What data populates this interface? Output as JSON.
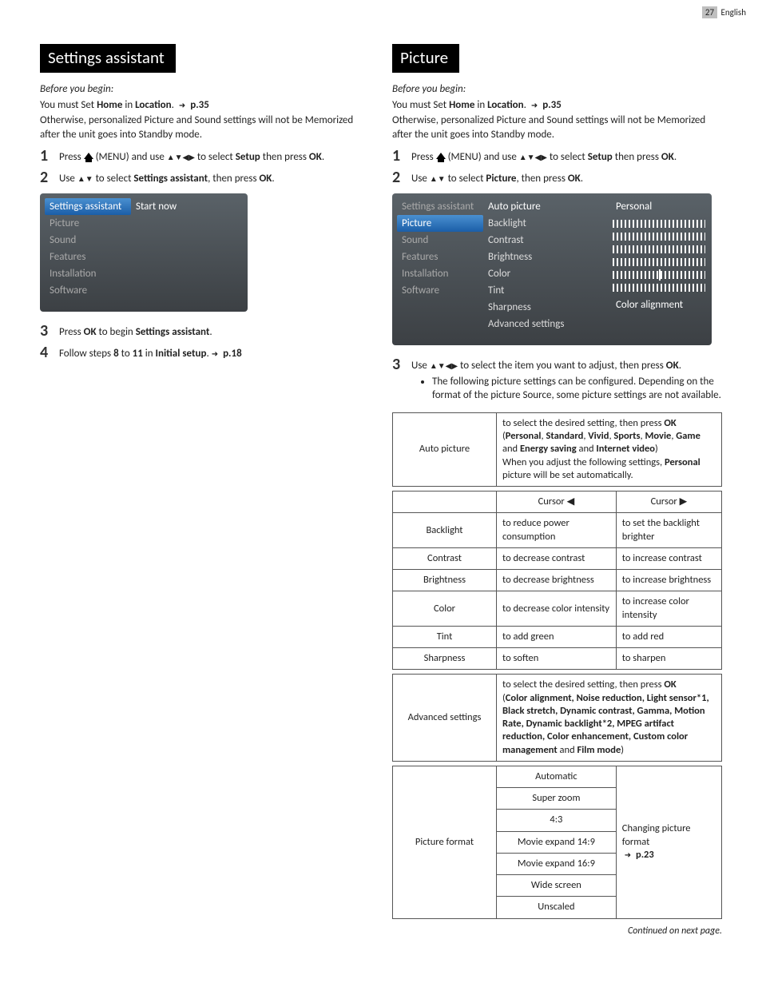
{
  "header": {
    "page_num": "27",
    "lang": "English"
  },
  "left": {
    "title": "Settings assistant",
    "before": "Before you begin:",
    "must_set": "You must Set ",
    "home": "Home",
    "in": " in ",
    "location": "Location",
    "period": ". ",
    "pref": "p.35",
    "otherwise": "Otherwise, personalized Picture and Sound settings will not be Memorized after the unit goes into Standby mode.",
    "steps": {
      "s1a": "Press ",
      "s1b": " (MENU) and use ",
      "s1c": " to select ",
      "s1d": " then press ",
      "setup": "Setup",
      "ok": "OK",
      "s2a": "Use ",
      "s2b": " to select ",
      "s2c": ", then press ",
      "sa": "Settings assistant",
      "s3a": "Press ",
      "s3b": " to begin ",
      "s4a": "Follow steps ",
      "s4b": " to ",
      "s4c": " in ",
      "eight": "8",
      "eleven": "11",
      "initial": "Initial setup",
      "p18": "p.18"
    },
    "menu": {
      "head": "Settings assistant",
      "right": "Start now",
      "items": [
        "Picture",
        "Sound",
        "Features",
        "Installation",
        "Software"
      ]
    }
  },
  "right": {
    "title": "Picture",
    "before": "Before you begin:",
    "must_set": "You must Set ",
    "home": "Home",
    "in": " in ",
    "location": "Location",
    "period": ". ",
    "pref": "p.35",
    "otherwise": "Otherwise, personalized Picture and Sound settings will not be Memorized after the unit goes into Standby mode.",
    "steps": {
      "s1a": "Press ",
      "s1b": " (MENU) and use ",
      "s1c": " to select ",
      "s1d": " then press ",
      "setup": "Setup",
      "ok": "OK",
      "s2a": "Use ",
      "s2b": " to select ",
      "s2c": ", then press ",
      "picture": "Picture",
      "s3a": "Use ",
      "s3b": " to select the item you want to adjust, then press ",
      "bullet": "The following picture settings can be configured. Depending on the format of the picture Source, some picture settings are not available."
    },
    "menu": {
      "left": [
        "Settings assistant",
        "Picture",
        "Sound",
        "Features",
        "Installation",
        "Software"
      ],
      "selected_left": 1,
      "mid": [
        "Auto picture",
        "Backlight",
        "Contrast",
        "Brightness",
        "Color",
        "Tint",
        "Sharpness",
        "Advanced settings"
      ],
      "vals": [
        "Personal",
        "",
        "",
        "",
        "",
        "",
        "",
        "Color alignment"
      ]
    },
    "table1": {
      "auto_label": "Auto picture",
      "auto_desc_1": "to select the desired setting, then press ",
      "auto_ok": "OK",
      "auto_desc_2": "(",
      "modes": [
        "Personal",
        "Standard",
        "Vivid",
        "Sports",
        "Movie",
        "Game",
        "Energy saving",
        "Internet video"
      ],
      "auto_and": " and ",
      "auto_close": ")",
      "auto_desc_3": "When you adjust the following settings, ",
      "personal": "Personal",
      "auto_desc_4": " picture will be set automatically.",
      "h_left": "Cursor ◀",
      "h_right": "Cursor ▶",
      "rows": [
        {
          "label": "Backlight",
          "l": "to reduce power consumption",
          "r": "to set the backlight brighter"
        },
        {
          "label": "Contrast",
          "l": "to decrease contrast",
          "r": "to increase contrast"
        },
        {
          "label": "Brightness",
          "l": "to decrease brightness",
          "r": "to increase brightness"
        },
        {
          "label": "Color",
          "l": "to decrease color intensity",
          "r": "to increase color intensity"
        },
        {
          "label": "Tint",
          "l": "to add green",
          "r": "to add red"
        },
        {
          "label": "Sharpness",
          "l": "to soften",
          "r": "to sharpen"
        }
      ],
      "adv_label": "Advanced settings",
      "adv_desc_1": "to select the desired setting, then press ",
      "adv_desc_2": "(",
      "adv_items": "Color alignment, Noise reduction, Light sensor*1, Black stretch, Dynamic contrast, Gamma, Motion Rate, Dynamic backlight*2, MPEG artifact reduction, Color enhancement, Custom color management",
      "adv_and": " and ",
      "film": "Film mode",
      "adv_close": ")",
      "pf_label": "Picture format",
      "pf_opts": [
        "Automatic",
        "Super zoom",
        "4:3",
        "Movie expand 14:9",
        "Movie expand 16:9",
        "Wide screen",
        "Unscaled"
      ],
      "pf_ref_1": "Changing picture format ",
      "pf_ref_2": "p.23"
    },
    "continued": "Continued on next page."
  }
}
